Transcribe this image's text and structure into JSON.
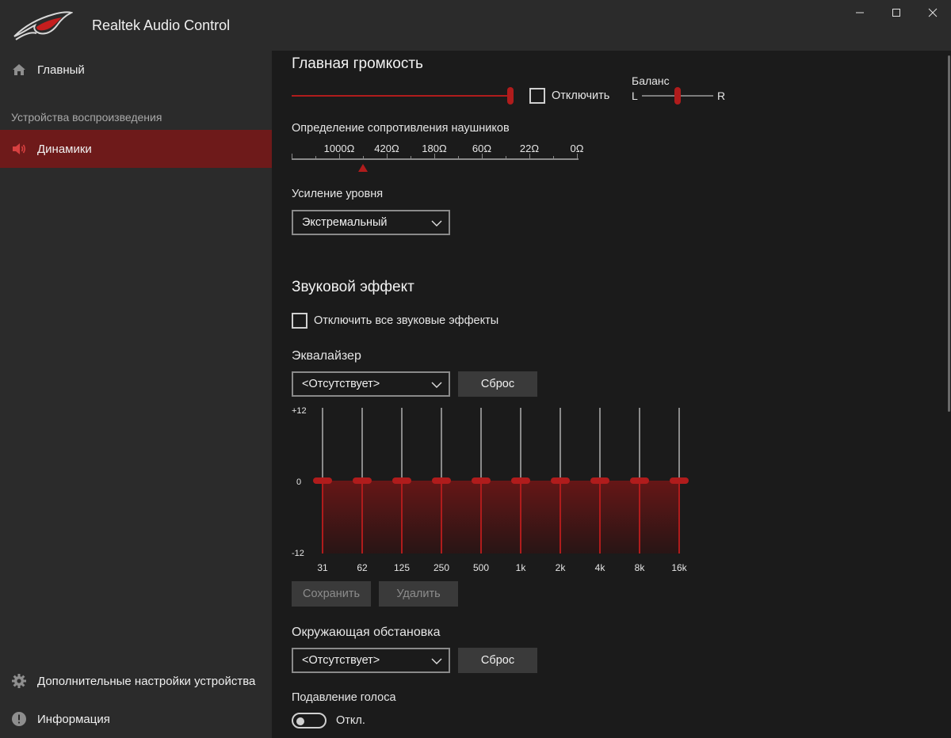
{
  "window": {
    "title": "Realtek Audio Control",
    "controls": [
      "minimize-icon",
      "maximize-icon",
      "close-icon"
    ]
  },
  "sidebar": {
    "home": {
      "label": "Главный",
      "icon": "home-icon"
    },
    "section_title": "Устройства воспроизведения",
    "speakers": {
      "label": "Динамики",
      "icon": "speaker-icon"
    },
    "advanced": {
      "label": "Дополнительные настройки устройства",
      "icon": "gear-icon"
    },
    "info": {
      "label": "Информация",
      "icon": "info-icon"
    },
    "accent": "#6e1a1a"
  },
  "volume": {
    "title": "Главная громкость",
    "level": 1.0,
    "mute_label": "Отключить",
    "muted": false,
    "balance_label": "Баланс",
    "balance_left": "L",
    "balance_right": "R",
    "balance_value": 0.5
  },
  "impedance": {
    "title": "Определение сопротивления наушников",
    "scale": [
      "1000Ω",
      "420Ω",
      "180Ω",
      "60Ω",
      "22Ω",
      "0Ω"
    ],
    "marker_value": "420Ω"
  },
  "gain": {
    "title": "Усиление уровня",
    "selected": "Экстремальный"
  },
  "effects": {
    "title": "Звуковой эффект",
    "disable_all_label": "Отключить все звуковые эффекты",
    "disable_all_checked": false
  },
  "equalizer": {
    "title": "Эквалайзер",
    "preset": "<Отсутствует>",
    "reset_label": "Сброс",
    "y_max_label": "+12",
    "y_zero_label": "0",
    "y_min_label": "-12",
    "range": [
      -12,
      12
    ],
    "bands": [
      {
        "freq": "31",
        "gain": 0
      },
      {
        "freq": "62",
        "gain": 0
      },
      {
        "freq": "125",
        "gain": 0
      },
      {
        "freq": "250",
        "gain": 0
      },
      {
        "freq": "500",
        "gain": 0
      },
      {
        "freq": "1k",
        "gain": 0
      },
      {
        "freq": "2k",
        "gain": 0
      },
      {
        "freq": "4k",
        "gain": 0
      },
      {
        "freq": "8k",
        "gain": 0
      },
      {
        "freq": "16k",
        "gain": 0
      }
    ],
    "save_label": "Сохранить",
    "delete_label": "Удалить",
    "accent": "#b01c1c"
  },
  "environment": {
    "title": "Окружающая обстановка",
    "preset": "<Отсутствует>",
    "reset_label": "Сброс"
  },
  "voice_cancel": {
    "title": "Подавление голоса",
    "state_label": "Откл.",
    "on": false
  }
}
